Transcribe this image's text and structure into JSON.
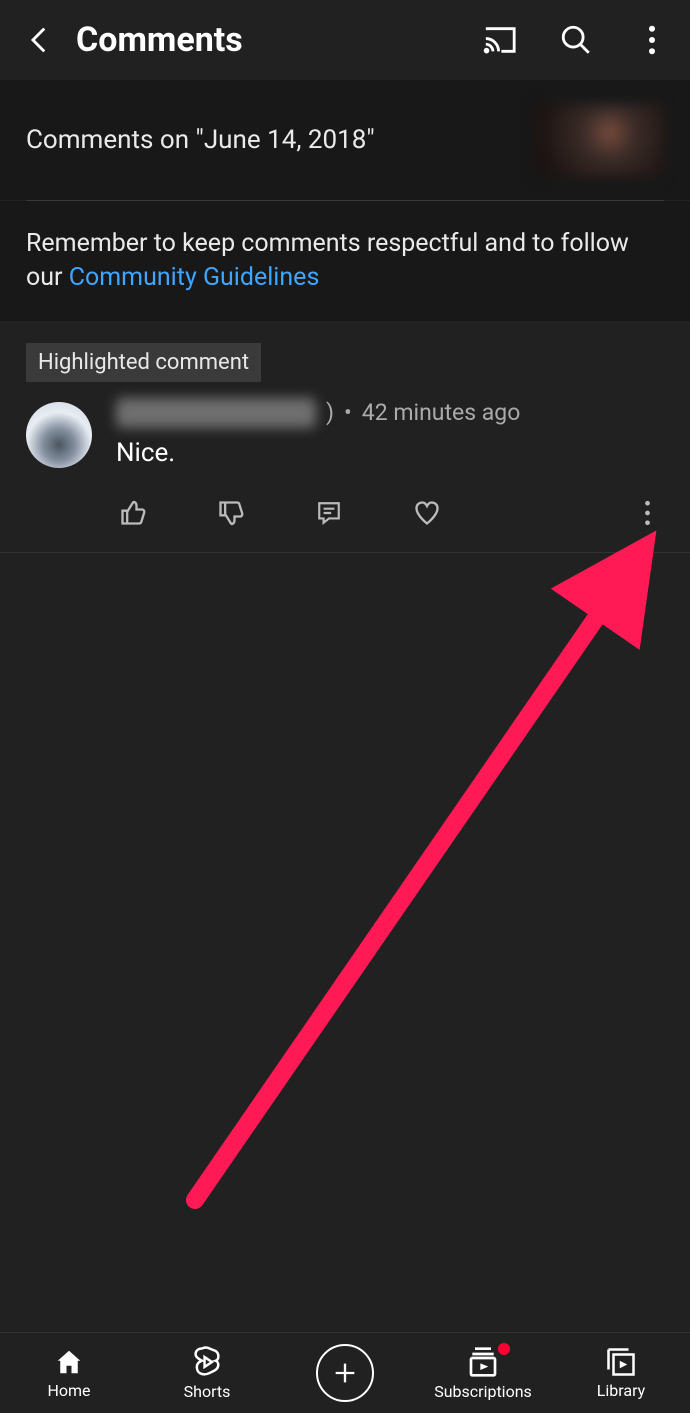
{
  "header": {
    "title": "Comments"
  },
  "video": {
    "comments_on": "Comments on \"June 14, 2018\""
  },
  "notice": {
    "prefix": "Remember to keep comments respectful and to follow our ",
    "link": "Community Guidelines"
  },
  "highlight_badge": "Highlighted comment",
  "comment": {
    "paren_close": ")",
    "bullet": "•",
    "timestamp": "42 minutes ago",
    "text": "Nice."
  },
  "nav": {
    "home": "Home",
    "shorts": "Shorts",
    "subscriptions": "Subscriptions",
    "library": "Library"
  }
}
